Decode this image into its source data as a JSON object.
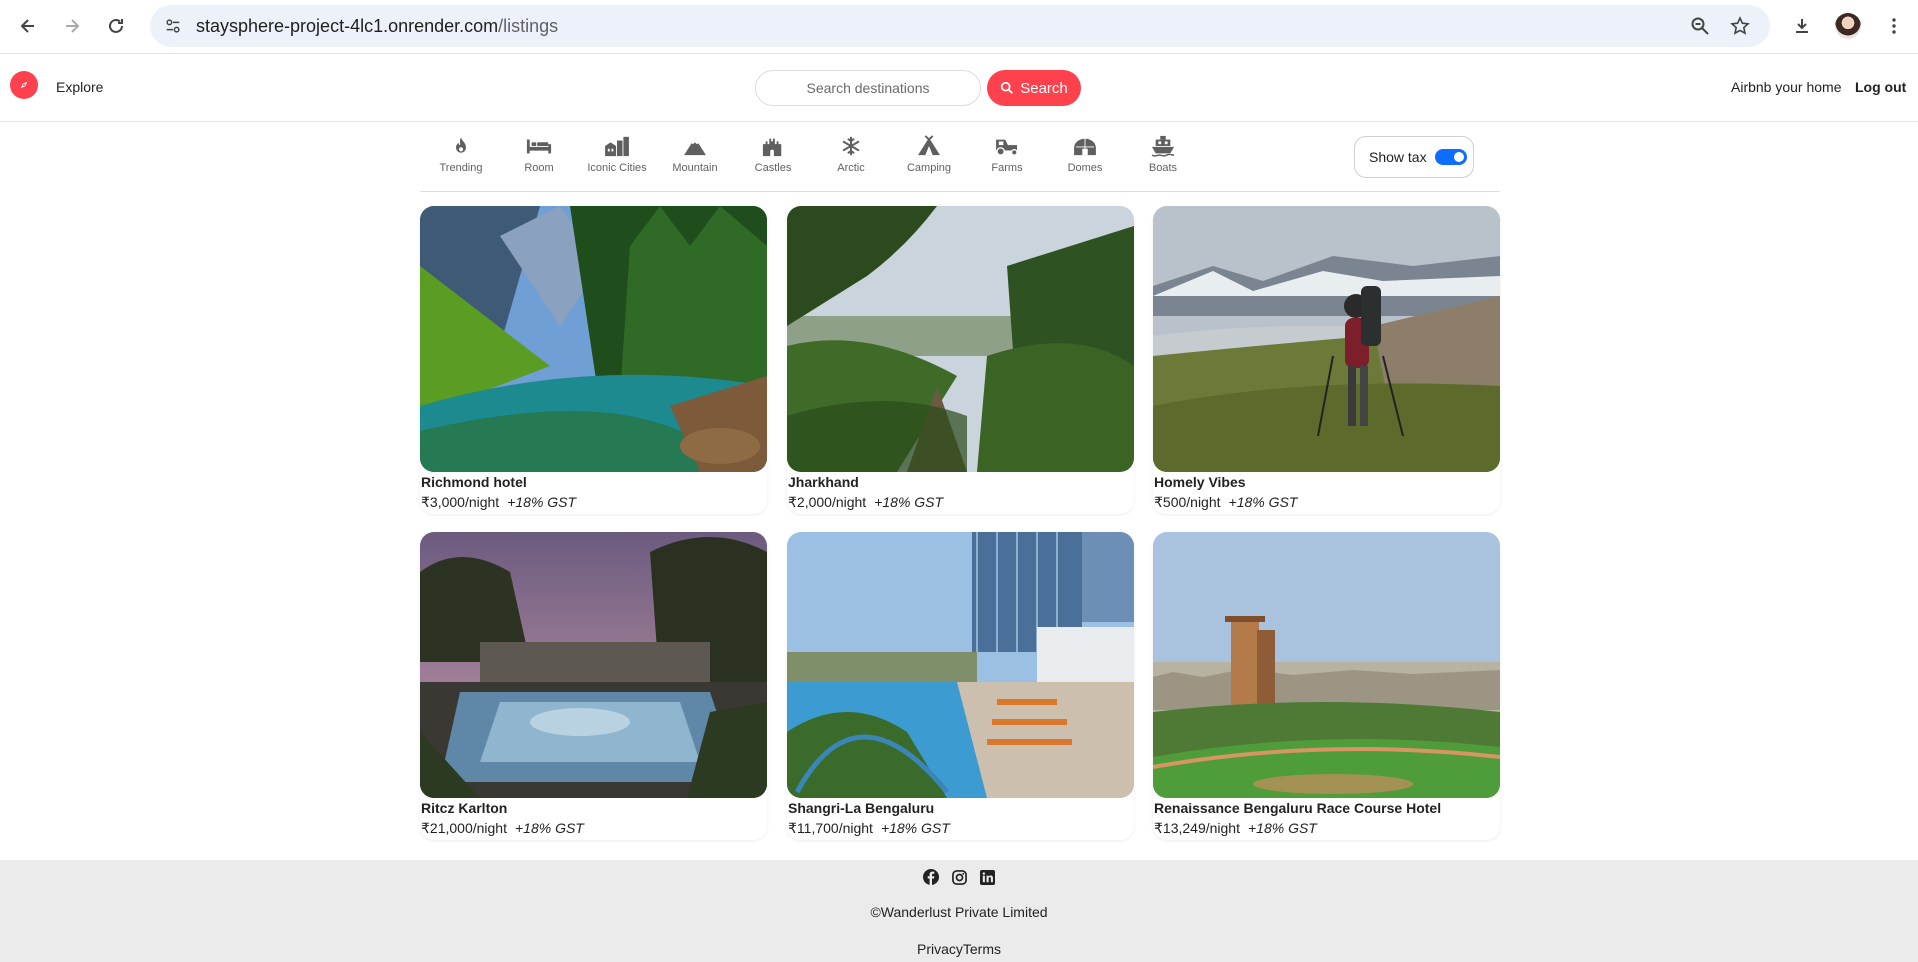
{
  "browser": {
    "url_host": "staysphere-project-4lc1.onrender.com",
    "url_path": "/listings"
  },
  "header": {
    "explore_label": "Explore",
    "search_placeholder": "Search destinations",
    "search_button_label": "Search",
    "host_label": "Airbnb your home",
    "logout_label": "Log out"
  },
  "filters": [
    {
      "label": "Trending",
      "icon": "fire-icon"
    },
    {
      "label": "Room",
      "icon": "bed-icon"
    },
    {
      "label": "Iconic Cities",
      "icon": "city-icon"
    },
    {
      "label": "Mountain",
      "icon": "mountain-icon"
    },
    {
      "label": "Castles",
      "icon": "castle-icon"
    },
    {
      "label": "Arctic",
      "icon": "snowflake-icon"
    },
    {
      "label": "Camping",
      "icon": "tent-icon"
    },
    {
      "label": "Farms",
      "icon": "tractor-icon"
    },
    {
      "label": "Domes",
      "icon": "dome-icon"
    },
    {
      "label": "Boats",
      "icon": "ship-icon"
    }
  ],
  "tax_toggle": {
    "label": "Show tax",
    "enabled": true
  },
  "listings": [
    {
      "title": "Richmond hotel",
      "price": "₹3,000/night",
      "gst": "+18% GST"
    },
    {
      "title": "Jharkhand",
      "price": "₹2,000/night",
      "gst": "+18% GST"
    },
    {
      "title": "Homely Vibes",
      "price": "₹500/night",
      "gst": "+18% GST"
    },
    {
      "title": "Ritcz Karlton",
      "price": "₹21,000/night",
      "gst": "+18% GST"
    },
    {
      "title": "Shangri-La Bengaluru",
      "price": "₹11,700/night",
      "gst": "+18% GST"
    },
    {
      "title": "Renaissance Bengaluru Race Course Hotel",
      "price": "₹13,249/night",
      "gst": "+18% GST"
    }
  ],
  "footer": {
    "copyright": "©Wanderlust Private Limited",
    "legal": "PrivacyTerms",
    "social_icons": [
      "facebook-icon",
      "instagram-icon",
      "linkedin-icon"
    ]
  },
  "colors": {
    "brand": "#fe424d",
    "toggle": "#0d6efd",
    "footer_bg": "#ebebeb"
  }
}
